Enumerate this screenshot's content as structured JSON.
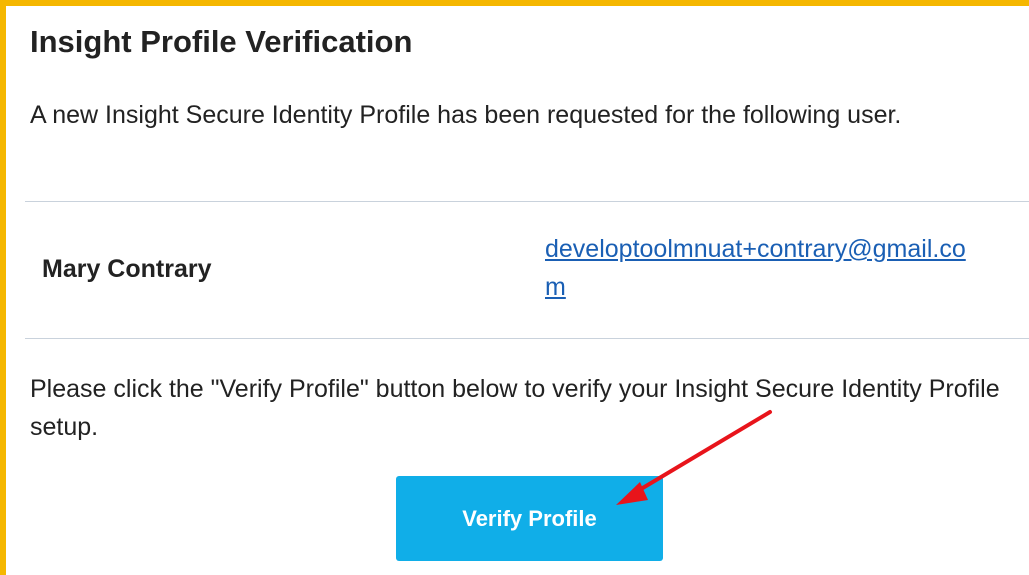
{
  "email_card": {
    "title": "Insight Profile Verification",
    "intro_text": "A new Insight Secure Identity Profile has been requested for the following user.",
    "user": {
      "name": "Mary Contrary",
      "email": "developtoolmnuat+contrary@gmail.com"
    },
    "instructions": "Please click the \"Verify Profile\" button below to verify your Insight Secure Identity Profile setup.",
    "verify_button_label": "Verify Profile"
  },
  "colors": {
    "frame_border": "#f5b700",
    "button_background": "#10aee8",
    "link": "#1a5fb4",
    "annotation_arrow": "#e8141b"
  },
  "icons": {
    "annotation": "red-arrow-icon"
  }
}
